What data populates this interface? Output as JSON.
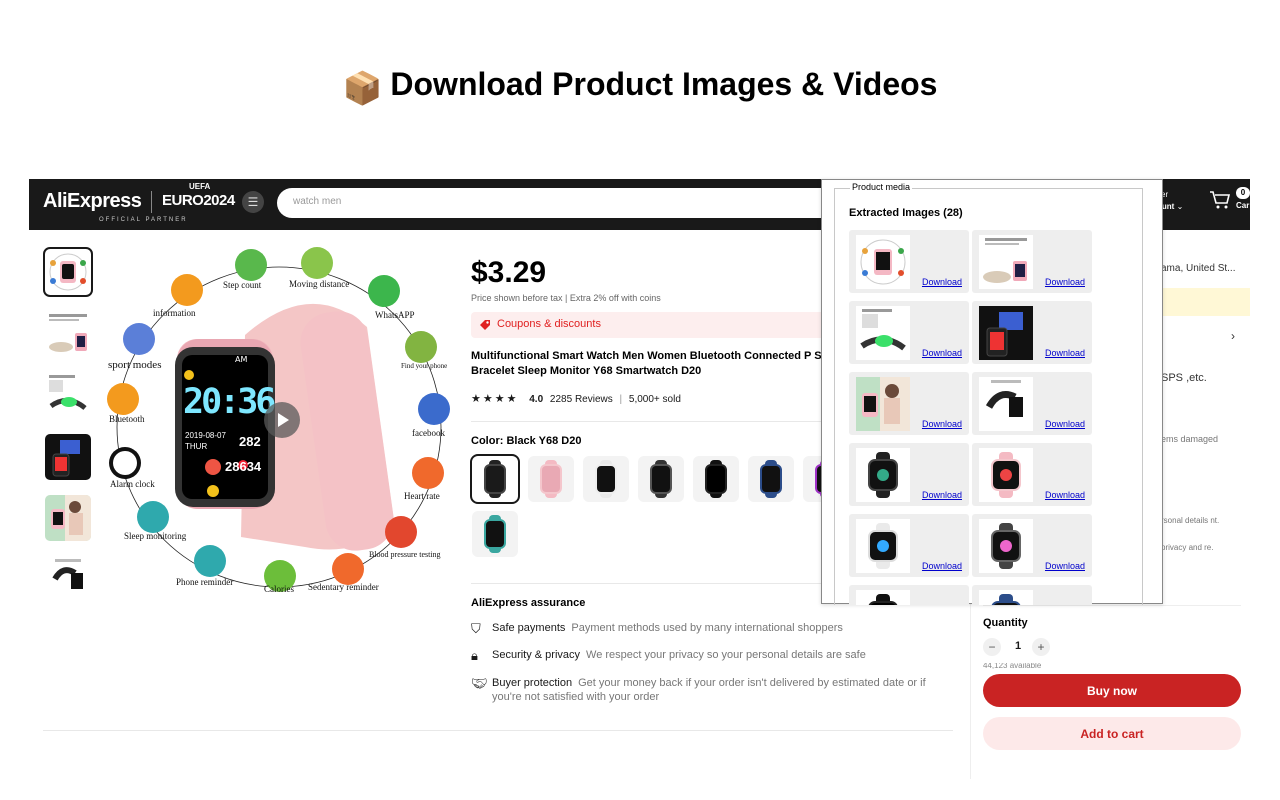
{
  "headline": {
    "emoji": "📦",
    "text": "Download Product Images & Videos"
  },
  "topbar": {
    "logo": "AliExpress",
    "euro_text": "EURO2024",
    "euro_badge": "UEFA",
    "partner_text": "OFFICIAL PARTNER",
    "search_value": "watch men",
    "account_line1": "ser",
    "account_line2": "ount",
    "cart_count": "0",
    "cart_label": "Car"
  },
  "product": {
    "price": "$3.29",
    "price_note": "Price shown before tax  |  Extra 2% off with coins",
    "coupon": "Coupons & discounts",
    "title": "Multifunctional Smart Watch Men Women Bluetooth Connected P Sports Bracelet Sleep Monitor Y68 Smartwatch D20",
    "rating_value": "4.0",
    "rating_stars": "★★★★",
    "reviews": "2285 Reviews",
    "sold": "5,000+ sold",
    "color_label": "Color: Black Y68 D20",
    "image_features": {
      "step": "Step count",
      "moving": "Moving distance",
      "whatsapp": "WhatsAPP",
      "info": "information",
      "findphone": "Find your phone",
      "sport": "sport modes",
      "facebook": "facebook",
      "bluetooth": "Bluetooth",
      "heart": "Heart rate",
      "alarm": "Alarm clock",
      "sleep": "Sleep monitoring",
      "bp": "Blood pressure testing",
      "phone": "Phone reminder",
      "calories": "Calories",
      "sedentary": "Sedentary reminder"
    },
    "watch_display": {
      "time": "20:36",
      "date": "2019-08-07",
      "day": "THUR",
      "ampm": "AM",
      "heart": "282",
      "steps": "28634"
    }
  },
  "assurance": {
    "title": "AliExpress assurance",
    "rows": [
      {
        "icon": "shield-check-icon",
        "head": "Safe payments",
        "desc": "Payment methods used by many international shoppers"
      },
      {
        "icon": "lock-icon",
        "head": "Security & privacy",
        "desc": "We respect your privacy so your personal details are safe"
      },
      {
        "icon": "handshake-icon",
        "head": "Buyer protection",
        "desc": "Get your money back if your order isn't delivered by estimated date or if you're not satisfied with your order"
      }
    ]
  },
  "right_column": {
    "ship_to": "ama, United St...",
    "gps": "SPS ,etc.",
    "damaged": "ems damaged",
    "personal": "rsonal details nt.",
    "privacy": "privacy and re.",
    "quantity_label": "Quantity",
    "quantity_value": "1",
    "quantity_minus": "−",
    "quantity_plus": "+",
    "availability": "44,123 available",
    "buy_now": "Buy now",
    "add_to_cart": "Add to cart"
  },
  "popup": {
    "legend": "Product media",
    "heading": "Extracted Images (28)",
    "download_label": "Download"
  },
  "colors": {
    "brand_dark": "#191919",
    "buy_red": "#c92323",
    "coupon_red": "#e02020",
    "link_blue": "#0000cc"
  }
}
